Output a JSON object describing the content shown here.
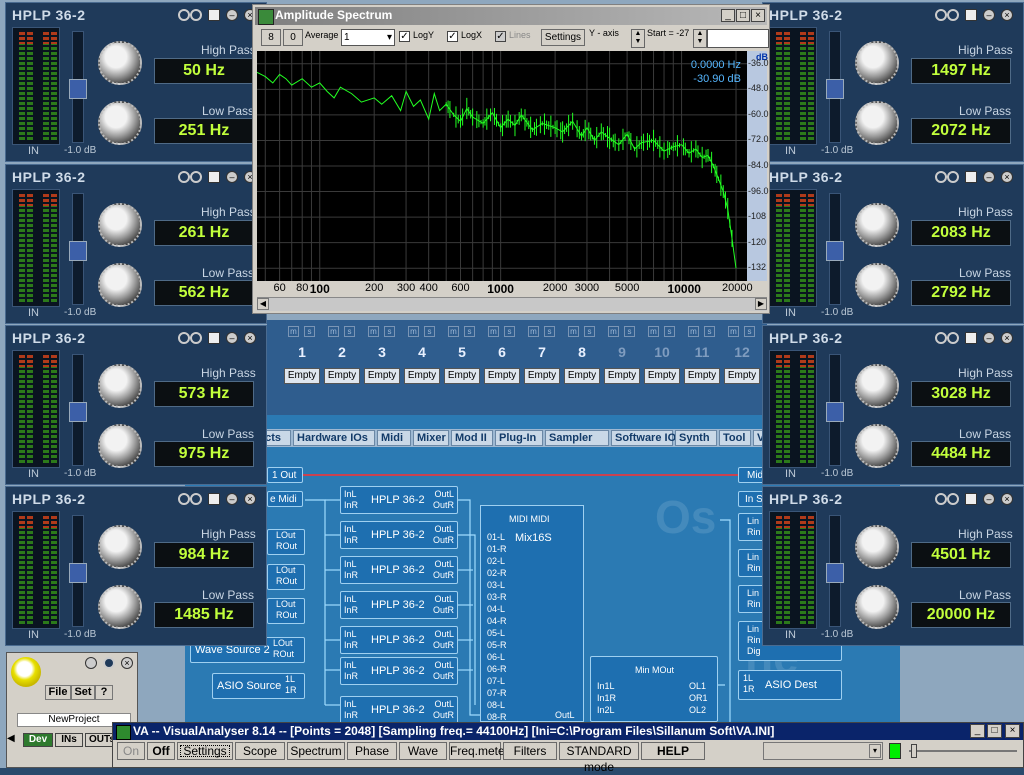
{
  "routing_tabs": [
    "ects",
    "Hardware IOs",
    "Midi",
    "Mixer",
    "Mod II",
    "Plug-In",
    "Sampler",
    "Software IOs",
    "Synth",
    "Tool",
    "V"
  ],
  "slots": {
    "numbers": [
      "1",
      "2",
      "3",
      "4",
      "5",
      "6",
      "7",
      "8",
      "9",
      "10",
      "11",
      "12"
    ],
    "ms": [
      "m",
      "s"
    ],
    "empty_label": "Empty"
  },
  "routing": {
    "hplp_node_name": "HPLP 36-2",
    "in_l": "InL",
    "in_r": "InR",
    "out_l": "OutL",
    "out_r": "OutR",
    "mix_name": "Mix16S",
    "mix_header": "MIDI MIDI",
    "mix_ports": [
      "01-L",
      "01-R",
      "02-L",
      "02-R",
      "03-L",
      "03-R",
      "04-L",
      "04-R",
      "05-L",
      "05-R",
      "06-L",
      "06-R",
      "07-L",
      "07-R",
      "08-L",
      "08-R"
    ],
    "left_nodes": [
      {
        "label": "1 Out"
      },
      {
        "label": "e Midi"
      },
      {
        "label": "LOut\nROut"
      },
      {
        "label": "LOut\nROut"
      },
      {
        "label": "LOut\nROut"
      },
      {
        "label": "Wave Source 2",
        "ports": "LOut\nROut"
      },
      {
        "label": "ASIO Source",
        "ports": "1L\n1R"
      }
    ],
    "right_nodes": [
      {
        "label": "Midi"
      },
      {
        "label": "In S"
      },
      {
        "label": "Lin\nRin"
      },
      {
        "label": "Lin\nRin"
      },
      {
        "label": "Lin\nRin"
      },
      {
        "label": "Lin\nRin\nDig"
      },
      {
        "label": "ASIO Dest",
        "ports": "1L\n1R"
      }
    ],
    "min_node": {
      "title": "Min MOut",
      "ports_left": [
        "In1L",
        "In1R",
        "In2L"
      ],
      "ports_right": [
        "OL1",
        "OR1",
        "OL2"
      ]
    },
    "outl": "OutL",
    "dig_dest": "Dig - Dig Dest"
  },
  "hplp_panels": [
    {
      "title": "HPLP 36-2",
      "high_pass_label": "High Pass",
      "high_pass": "50 Hz",
      "low_pass_label": "Low Pass",
      "low_pass": "251 Hz",
      "in_label": "IN",
      "db_label": "-1.0 dB"
    },
    {
      "title": "HPLP 36-2",
      "high_pass_label": "High Pass",
      "high_pass": "261 Hz",
      "low_pass_label": "Low Pass",
      "low_pass": "562 Hz",
      "in_label": "IN",
      "db_label": "-1.0 dB"
    },
    {
      "title": "HPLP 36-2",
      "high_pass_label": "High Pass",
      "high_pass": "573 Hz",
      "low_pass_label": "Low Pass",
      "low_pass": "975 Hz",
      "in_label": "IN",
      "db_label": "-1.0 dB"
    },
    {
      "title": "HPLP 36-2",
      "high_pass_label": "High Pass",
      "high_pass": "984 Hz",
      "low_pass_label": "Low Pass",
      "low_pass": "1485 Hz",
      "in_label": "IN",
      "db_label": "-1.0 dB"
    },
    {
      "title": "HPLP 36-2",
      "high_pass_label": "High Pass",
      "high_pass": "1497 Hz",
      "low_pass_label": "Low Pass",
      "low_pass": "2072 Hz",
      "in_label": "IN",
      "db_label": "-1.0 dB"
    },
    {
      "title": "HPLP 36-2",
      "high_pass_label": "High Pass",
      "high_pass": "2083 Hz",
      "low_pass_label": "Low Pass",
      "low_pass": "2792 Hz",
      "in_label": "IN",
      "db_label": "-1.0 dB"
    },
    {
      "title": "HPLP 36-2",
      "high_pass_label": "High Pass",
      "high_pass": "3028 Hz",
      "low_pass_label": "Low Pass",
      "low_pass": "4484 Hz",
      "in_label": "IN",
      "db_label": "-1.0 dB"
    },
    {
      "title": "HPLP 36-2",
      "high_pass_label": "High Pass",
      "high_pass": "4501 Hz",
      "low_pass_label": "Low Pass",
      "low_pass": "20000 Hz",
      "in_label": "IN",
      "db_label": "-1.0 dB"
    }
  ],
  "spectrum": {
    "title": "Amplitude Spectrum",
    "btn_8": "8",
    "btn_0": "0",
    "average_label": "Average",
    "average_value": "1",
    "logy_label": "LogY",
    "logx_label": "LogX",
    "lines_label": "Lines",
    "settings_label": "Settings",
    "yaxis_label": "Y - axis",
    "start_label": "Start = -27",
    "readout_hz": "0.0000 Hz",
    "readout_db": "-30.90 dB",
    "db_unit": "dB",
    "y_ticks": [
      "-36.0",
      "-48.0",
      "-60.0",
      "-72.0",
      "-84.0",
      "-96.0",
      "-108",
      "-120",
      "-132"
    ],
    "x_ticks": [
      "60",
      "80",
      "100",
      "200",
      "300",
      "400",
      "600",
      "1000",
      "2000",
      "3000",
      "5000",
      "10000",
      "20000"
    ],
    "bold_x_ticks": [
      "100",
      "1000",
      "10000"
    ],
    "trace_color": "#22ff22"
  },
  "chart_data": {
    "type": "line",
    "title": "Amplitude Spectrum",
    "xscale": "log",
    "ylabel": "dB",
    "xlim": [
      45,
      23000
    ],
    "ylim": [
      -138,
      -30
    ],
    "series": [
      {
        "x": [
          45,
          50,
          55,
          60,
          65,
          70,
          80,
          90,
          100,
          110,
          120,
          130,
          150,
          170,
          200,
          220,
          250,
          280,
          300,
          330,
          360,
          400,
          430,
          460,
          500,
          550,
          600,
          650,
          700,
          800,
          900,
          1000,
          1100,
          1200,
          1300,
          1500,
          1700,
          2000,
          2200,
          2500,
          2800,
          3000,
          3300,
          3600,
          4000,
          4500,
          5000,
          5500,
          6000,
          7000,
          8000,
          9000,
          10000,
          11000,
          12000,
          13000,
          14000,
          15000,
          16000,
          17000,
          18000,
          19000,
          20000
        ],
        "y": [
          -40,
          -42,
          -45,
          -41,
          -43,
          -46,
          -43,
          -47,
          -45,
          -49,
          -52,
          -47,
          -50,
          -54,
          -52,
          -55,
          -51,
          -58,
          -49,
          -56,
          -53,
          -62,
          -50,
          -58,
          -55,
          -60,
          -63,
          -57,
          -61,
          -64,
          -59,
          -66,
          -62,
          -65,
          -60,
          -67,
          -64,
          -66,
          -68,
          -63,
          -70,
          -66,
          -72,
          -68,
          -71,
          -74,
          -69,
          -76,
          -73,
          -72,
          -77,
          -75,
          -74,
          -78,
          -76,
          -80,
          -79,
          -84,
          -90,
          -96,
          -104,
          -118,
          -132
        ]
      }
    ],
    "grid": true
  },
  "va_small": {
    "menu": [
      "File",
      "Set",
      "?"
    ],
    "project": "NewProject",
    "tabs": [
      "Dev",
      "INs",
      "OUTs"
    ]
  },
  "va_bar": {
    "title": "VA -- VisualAnalyser 8.14 --  [Points = 2048]  [Sampling freq.= 44100Hz]  [Ini=C:\\Program Files\\Sillanum Soft\\VA.INI]",
    "buttons": [
      "On",
      "Off",
      "Settings",
      "Scope",
      "Spectrum",
      "Phase",
      "Wave",
      "Freq.meter",
      "Filters",
      "STANDARD mode",
      "HELP"
    ]
  },
  "colors": {
    "lcd_text": "#c2ff3c",
    "panel_bg": "#1f3a5a",
    "routing_bg": "#2b7ab3",
    "trace": "#22ff22",
    "va_title": "#0a246a"
  }
}
